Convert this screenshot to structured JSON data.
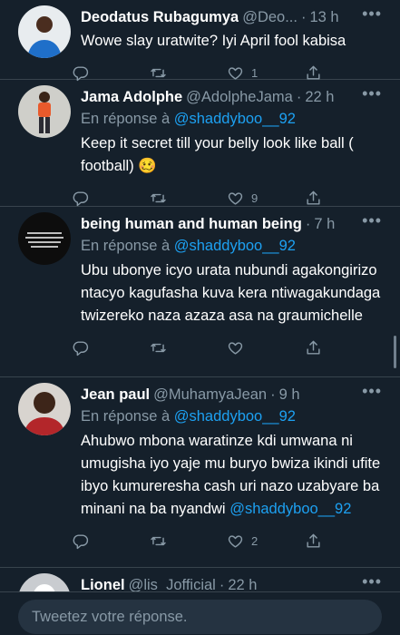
{
  "tweets": [
    {
      "name": "Deodatus Rubagumya",
      "handle": "@Deo...",
      "dot": "·",
      "time": "13 h",
      "reply_prefix": "",
      "reply_mention": "",
      "text": "Wowe slay uratwite? Iyi April fool kabisa",
      "trail_mention": "",
      "replies": "",
      "retweets": "",
      "likes": "1"
    },
    {
      "name": "Jama Adolphe",
      "handle": "@AdolpheJama",
      "dot": "·",
      "time": "22 h",
      "reply_prefix": "En réponse à ",
      "reply_mention": "@shaddyboo__92",
      "text": "Keep it secret till your belly look like ball ( football)",
      "emoji": "🥴",
      "trail_mention": "",
      "replies": "",
      "retweets": "",
      "likes": "9"
    },
    {
      "name": "being human and human being",
      "handle": "",
      "dot": "·",
      "time": "7 h",
      "reply_prefix": "En réponse à ",
      "reply_mention": "@shaddyboo__92",
      "text": "Ubu ubonye icyo urata nubundi agakongirizo ntacyo kagufasha kuva kera ntiwagakundaga twizereko naza azaza asa na graumichelle",
      "trail_mention": "",
      "replies": "",
      "retweets": "",
      "likes": ""
    },
    {
      "name": "Jean paul",
      "handle": "@MuhamyaJean",
      "dot": "·",
      "time": "9 h",
      "reply_prefix": "En réponse à ",
      "reply_mention": "@shaddyboo__92",
      "text": "Ahubwo mbona waratinze kdi umwana ni umugisha iyo yaje mu buryo bwiza ikindi ufite ibyo kumureresha cash uri nazo uzabyare ba minani na ba nyandwi",
      "trail_mention": "@shaddyboo__92",
      "replies": "",
      "retweets": "",
      "likes": "2"
    },
    {
      "name": "Lionel",
      "handle": "@lis_Jofficial",
      "dot": "·",
      "time": "22 h",
      "reply_prefix": "",
      "reply_mention": "",
      "text": "",
      "trail_mention": "",
      "replies": "",
      "retweets": "",
      "likes": ""
    }
  ],
  "composer": {
    "placeholder": "Tweetez votre réponse."
  },
  "colors": {
    "background": "#15202b",
    "accent": "#1da1f2",
    "muted": "#8899a6",
    "divider": "#38444d"
  },
  "icons": [
    "reply-icon",
    "retweet-icon",
    "like-icon",
    "share-icon",
    "more-icon"
  ]
}
